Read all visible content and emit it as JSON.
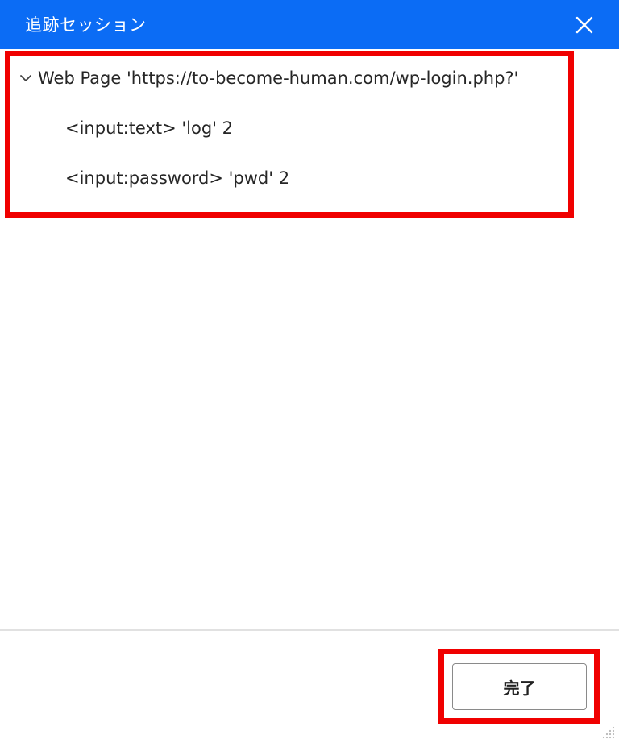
{
  "window": {
    "title": "追跡セッション",
    "close_icon": "close-icon",
    "accent_color": "#0b6cf5"
  },
  "tree": {
    "root": {
      "label": "Web Page 'https://to-become-human.com/wp-login.php?'",
      "expanded": true,
      "icon": "chevron-down-icon"
    },
    "children": [
      {
        "label": "<input:text> 'log' 2"
      },
      {
        "label": "<input:password> 'pwd' 2"
      }
    ]
  },
  "footer": {
    "done_label": "完了"
  },
  "annotation": {
    "highlight_color": "#f00000"
  }
}
